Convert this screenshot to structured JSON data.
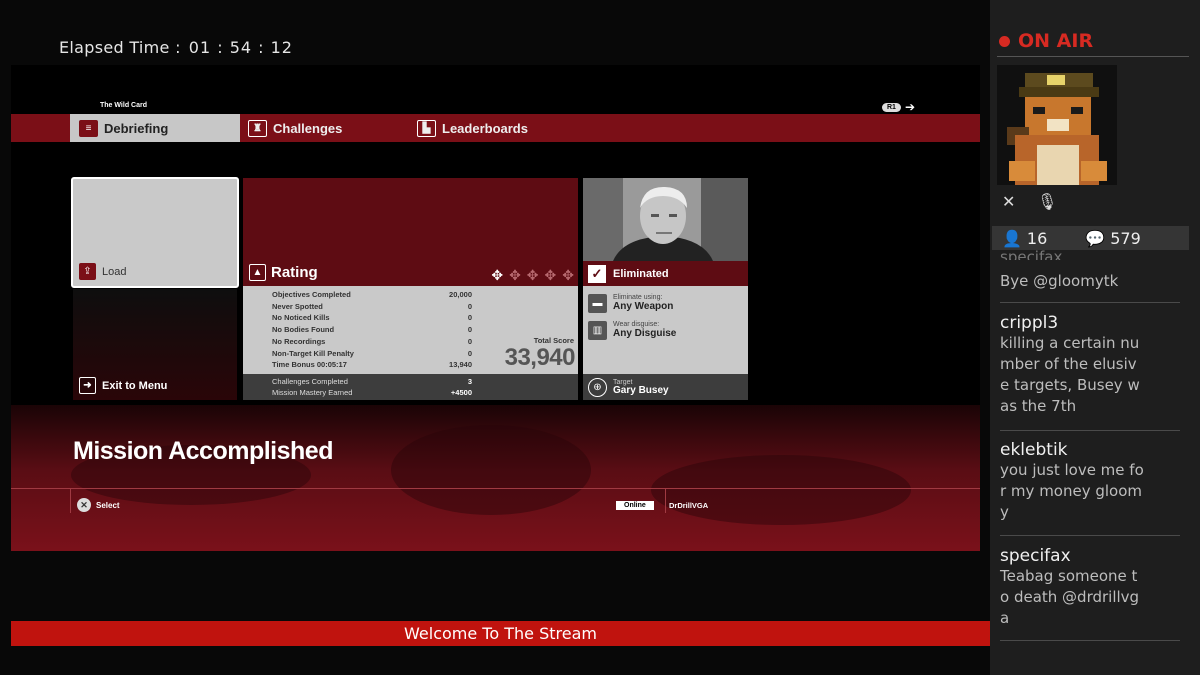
{
  "elapsed": {
    "label": "Elapsed Time :",
    "time": "01 : 54 : 12"
  },
  "game": {
    "contract": "The Wild Card",
    "r1_label": "R1",
    "tabs": [
      {
        "label": "Debriefing",
        "icon": "document-icon"
      },
      {
        "label": "Challenges",
        "icon": "trophy-icon"
      },
      {
        "label": "Leaderboards",
        "icon": "podium-icon"
      }
    ],
    "load_label": "Load",
    "exit_label": "Exit to Menu",
    "rating": {
      "title": "Rating",
      "stars_earned": 1,
      "stars_total": 5,
      "rows": [
        {
          "label": "Objectives Completed",
          "value": "20,000"
        },
        {
          "label": "Never Spotted",
          "value": "0"
        },
        {
          "label": "No Noticed Kills",
          "value": "0"
        },
        {
          "label": "No Bodies Found",
          "value": "0"
        },
        {
          "label": "No Recordings",
          "value": "0"
        },
        {
          "label": "Non-Target Kill Penalty",
          "value": "0"
        },
        {
          "label": "Time Bonus 00:05:17",
          "value": "13,940"
        }
      ],
      "footer_rows": [
        {
          "label": "Challenges Completed",
          "value": "3"
        },
        {
          "label": "Mission Mastery Earned",
          "value": "+4500"
        }
      ],
      "total_label": "Total Score",
      "total_value": "33,940"
    },
    "target": {
      "status": "Eliminated",
      "weapon_sub": "Eliminate using:",
      "weapon": "Any Weapon",
      "disguise_sub": "Wear disguise:",
      "disguise": "Any Disguise",
      "target_sub": "Target",
      "target_name": "Gary Busey"
    },
    "mission_status": "Mission Accomplished",
    "select_label": "Select",
    "online_label": "Online",
    "gamertag": "DrDrillVGA"
  },
  "welcome": "Welcome To The Stream",
  "stream": {
    "status": "ON AIR",
    "viewers": "16",
    "comments": "579",
    "status_color": "#d72a22"
  },
  "chat": [
    {
      "user": "specifax",
      "text": "Bye @gloomytk"
    },
    {
      "user": "crippl3",
      "text": "killing a certain number of the elusive targets, Busey was the 7th"
    },
    {
      "user": "eklebtik",
      "text": "you just love me for my money gloomy"
    },
    {
      "user": "specifax",
      "text": "Teabag someone to death @drdrillvga"
    }
  ]
}
